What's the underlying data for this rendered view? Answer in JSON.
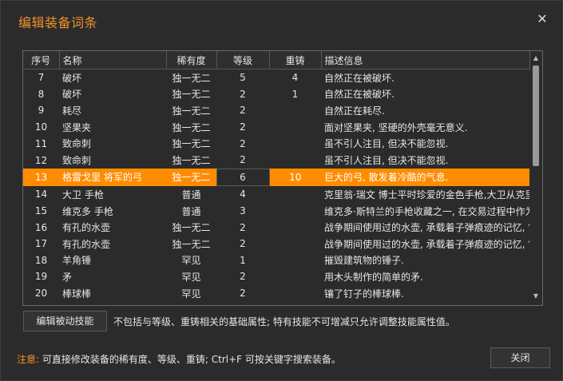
{
  "dialog": {
    "title": "编辑装备词条",
    "close_symbol": "✕"
  },
  "table": {
    "columns": [
      "序号",
      "名称",
      "稀有度",
      "等级",
      "重铸",
      "描述信息"
    ],
    "rows": [
      {
        "id": "7",
        "name": "破坏",
        "rarity": "独一无二",
        "level": "5",
        "reforge": "4",
        "desc": "自然正在被破坏."
      },
      {
        "id": "8",
        "name": "破坏",
        "rarity": "独一无二",
        "level": "2",
        "reforge": "1",
        "desc": "自然正在被破坏."
      },
      {
        "id": "9",
        "name": "耗尽",
        "rarity": "独一无二",
        "level": "2",
        "reforge": "",
        "desc": "自然正在耗尽."
      },
      {
        "id": "10",
        "name": "坚果夹",
        "rarity": "独一无二",
        "level": "2",
        "reforge": "",
        "desc": "面对坚果夹, 坚硬的外壳毫无意义."
      },
      {
        "id": "11",
        "name": "致命刺",
        "rarity": "独一无二",
        "level": "2",
        "reforge": "",
        "desc": "虽不引人注目, 但决不能忽视."
      },
      {
        "id": "12",
        "name": "致命刺",
        "rarity": "独一无二",
        "level": "2",
        "reforge": "",
        "desc": "虽不引人注目, 但决不能忽视."
      },
      {
        "id": "13",
        "name": "格雷戈里 将军的弓",
        "rarity": "独一无二",
        "level": "6",
        "reforge": "10",
        "desc": "巨大的弓, 散发着冷酷的气息."
      },
      {
        "id": "14",
        "name": "大卫 手枪",
        "rarity": "普通",
        "level": "4",
        "reforge": "",
        "desc": "克里翁·瑞文 博士平时珍爱的金色手枪,大卫从克里"
      },
      {
        "id": "15",
        "name": "维克多 手枪",
        "rarity": "普通",
        "level": "3",
        "reforge": "",
        "desc": "维克多·斯特兰的手枪收藏之一, 在交易过程中作为"
      },
      {
        "id": "16",
        "name": "有孔的水壶",
        "rarity": "独一无二",
        "level": "2",
        "reforge": "",
        "desc": "战争期间使用过的水壶, 承载着子弹痕迹的记忆, 它"
      },
      {
        "id": "17",
        "name": "有孔的水壶",
        "rarity": "独一无二",
        "level": "2",
        "reforge": "",
        "desc": "战争期间使用过的水壶, 承载着子弹痕迹的记忆, 它"
      },
      {
        "id": "18",
        "name": "羊角锤",
        "rarity": "罕见",
        "level": "1",
        "reforge": "",
        "desc": "摧毁建筑物的锤子."
      },
      {
        "id": "19",
        "name": "矛",
        "rarity": "罕见",
        "level": "2",
        "reforge": "",
        "desc": "用木头制作的简单的矛."
      },
      {
        "id": "20",
        "name": "棒球棒",
        "rarity": "罕见",
        "level": "2",
        "reforge": "",
        "desc": "镶了钉子的棒球棒."
      }
    ],
    "selected_index": 6
  },
  "edit_passive_button": "编辑被动技能",
  "passive_note": "不包括与等级、重铸相关的基础属性; 特有技能不可增减只允许调整技能属性值。",
  "footer": {
    "warn_label": "注意:",
    "note": " 可直接修改装备的稀有度、等级、重铸; Ctrl+F 可按关键字搜索装备。",
    "close_button": "关闭"
  },
  "colors": {
    "accent": "#f0922a",
    "selection": "#ff8c00",
    "background": "#2b2b2b"
  }
}
